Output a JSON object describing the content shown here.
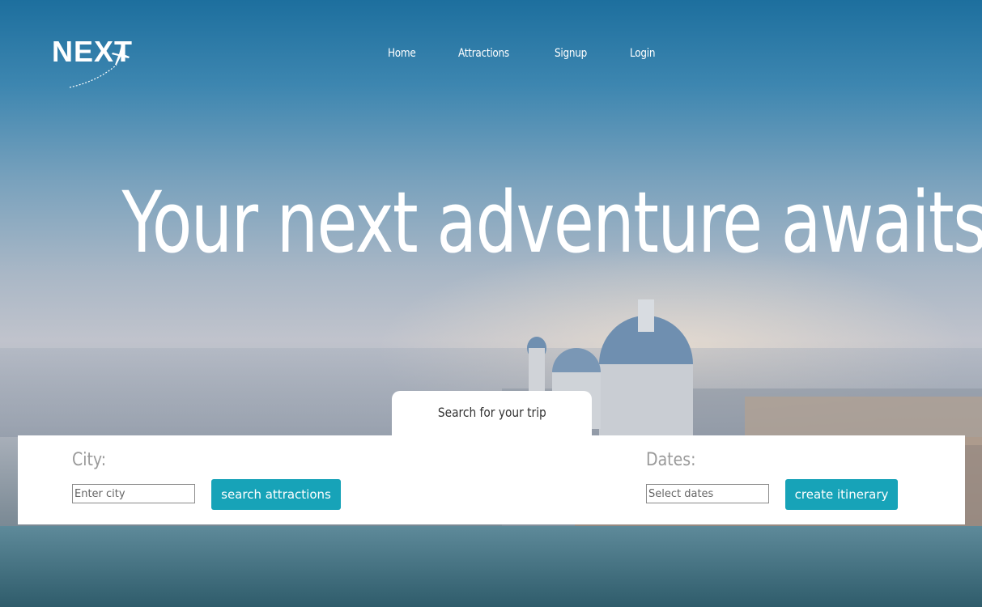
{
  "brand": {
    "logo_text": "NEXT"
  },
  "nav": {
    "items": [
      {
        "label": "Home"
      },
      {
        "label": "Attractions"
      },
      {
        "label": "Signup"
      },
      {
        "label": "Login"
      }
    ]
  },
  "hero": {
    "title": "Your next adventure awaits"
  },
  "search": {
    "tab_label": "Search for your trip",
    "city": {
      "label": "City:",
      "placeholder": "Enter city",
      "button_label": "search attractions"
    },
    "dates": {
      "label": "Dates:",
      "placeholder": "Select dates",
      "button_label": "create itinerary"
    }
  },
  "colors": {
    "accent": "#17a3b8",
    "panel_bg": "#ffffff",
    "label_gray": "#9a9a9a"
  }
}
